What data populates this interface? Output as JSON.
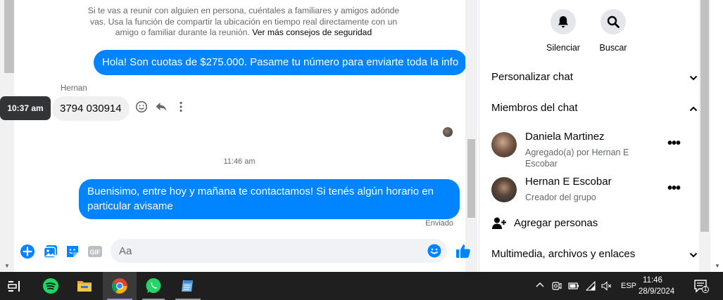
{
  "chat": {
    "safety_notice": "Si te vas a reunir con alguien en persona, cuéntales a familiares y amigos adónde vas. Usa la función de compartir la ubicación en tiempo real directamente con un amigo o familiar durante la reunión.",
    "safety_link": "Ver más consejos de seguridad",
    "messages": [
      {
        "direction": "out",
        "text": "Hola! Son cuotas de $275.000. Pasame tu número para enviarte toda la info"
      },
      {
        "direction": "in",
        "sender": "Hernan",
        "text": "3794 030914",
        "hover_time": "10:37 am"
      },
      {
        "direction": "out",
        "text": "Buenisimo, entre hoy y mañana te contactamos! Si tenés algún horario en particular avisame"
      }
    ],
    "time_separator": "11:46 am",
    "status": "Enviado",
    "composer": {
      "placeholder": "Aa"
    }
  },
  "info_panel": {
    "actions": [
      {
        "label": "Silenciar",
        "icon": "bell-icon"
      },
      {
        "label": "Buscar",
        "icon": "search-icon"
      }
    ],
    "sections": {
      "customize": "Personalizar chat",
      "members": "Miembros del chat",
      "media": "Multimedia, archivos y enlaces"
    },
    "members": [
      {
        "name": "Daniela Martinez",
        "subtitle": "Agregado(a) por Hernan E Escobar"
      },
      {
        "name": "Hernan E Escobar",
        "subtitle": "Creador del grupo"
      }
    ],
    "add_people": "Agregar personas"
  },
  "taskbar": {
    "apps": [
      "task-view-icon",
      "spotify-icon",
      "file-explorer-icon",
      "chrome-icon",
      "whatsapp-icon",
      "notepad-icon"
    ],
    "language": "ESP",
    "time": "11:46",
    "date": "28/9/2024",
    "notifications": "1"
  },
  "colors": {
    "messenger_blue": "#0084ff",
    "taskbar": "#1f1f1f"
  }
}
